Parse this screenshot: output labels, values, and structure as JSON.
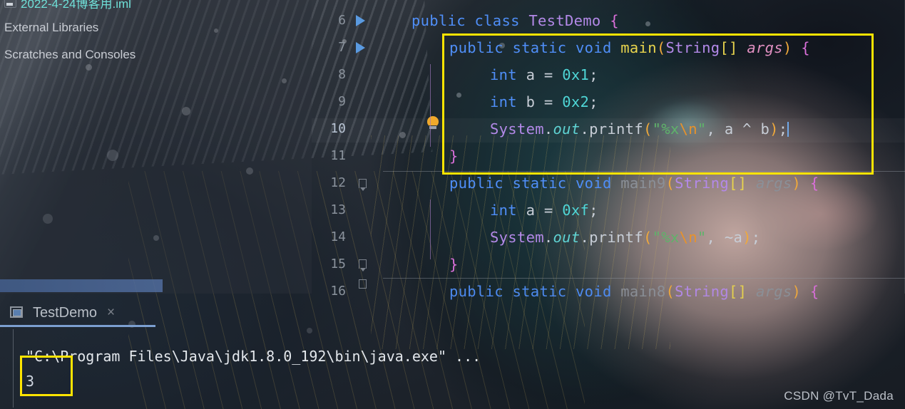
{
  "project_tree": {
    "items": [
      {
        "label": "2022-4-24博客用.iml",
        "icon": "module-file-icon"
      },
      {
        "label": "External Libraries",
        "icon": "library-icon"
      },
      {
        "label": "Scratches and Consoles",
        "icon": "scratch-icon"
      }
    ]
  },
  "editor": {
    "line_numbers": [
      "6",
      "7",
      "8",
      "9",
      "10",
      "11",
      "12",
      "13",
      "14",
      "15",
      "16"
    ],
    "current_line": "10",
    "lines": {
      "l6": {
        "num": "6",
        "text": "public class TestDemo {"
      },
      "l7": {
        "num": "7",
        "text": "    public static void main(String[] args) {"
      },
      "l8": {
        "num": "8",
        "text": "        int a = 0x1;"
      },
      "l9": {
        "num": "9",
        "text": "        int b = 0x2;"
      },
      "l10": {
        "num": "10",
        "text": "        System.out.printf(\"%x\\n\", a ^ b);"
      },
      "l11": {
        "num": "11",
        "text": "    }"
      },
      "l12": {
        "num": "12",
        "text": "    public static void main9(String[] args) {"
      },
      "l13": {
        "num": "13",
        "text": "        int a = 0xf;"
      },
      "l14": {
        "num": "14",
        "text": "        System.out.printf(\"%x\\n\", ~a);"
      },
      "l15": {
        "num": "15",
        "text": "    }"
      },
      "l16": {
        "num": "16",
        "text": "    public static void main8(String[] args) {"
      }
    },
    "tokens": {
      "kw_public": "public",
      "kw_class": "class",
      "kw_static": "static",
      "kw_void": "void",
      "kw_int": "int",
      "type_TestDemo": "TestDemo",
      "type_String": "String",
      "type_System": "System",
      "field_out": "out",
      "method_main": "main",
      "method_main9": "main9",
      "method_main8": "main8",
      "method_printf": "printf",
      "var_a": "a",
      "var_b": "b",
      "var_args": "args",
      "num_0x1": "0x1",
      "num_0x2": "0x2",
      "num_0xf": "0xf",
      "str_fmt": "\"%x",
      "str_esc": "\\n",
      "str_end": "\"",
      "op_assign": "=",
      "op_xor": "^",
      "op_not": "~",
      "brace_open": "{",
      "brace_close": "}",
      "paren_open": "(",
      "paren_close": ")",
      "bracket": "[]",
      "comma": ",",
      "semicolon": ";",
      "dot": "."
    },
    "gutter": {
      "run_arrow_lines": [
        "6",
        "7"
      ],
      "bulb_line": "10",
      "intention_icon": "lightbulb-icon"
    }
  },
  "run_panel": {
    "tab_label": "TestDemo",
    "tab_close": "×",
    "tab_icon": "console-icon",
    "console": {
      "command_line": "\"C:\\Program Files\\Java\\jdk1.8.0_192\\bin\\java.exe\" ...",
      "output": "3"
    }
  },
  "highlights": {
    "method_box_color": "#ffe400",
    "output_box_color": "#ffe400"
  },
  "watermark": {
    "text": "CSDN @TvT_Dada"
  }
}
